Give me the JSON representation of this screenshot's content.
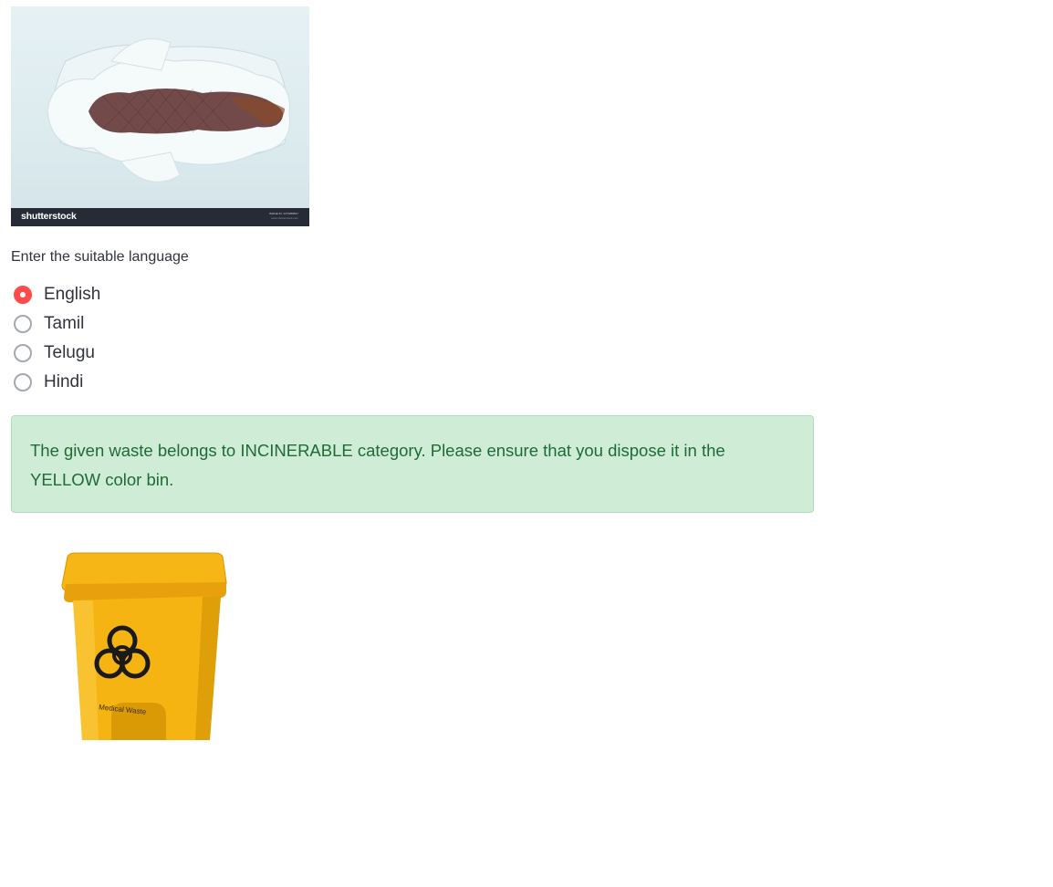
{
  "waste_image": {
    "watermark_brand": "shutterstock",
    "watermark_id_line1": "IMAGE ID: 1273068817",
    "watermark_id_line2": "www.shutterstock.com"
  },
  "language": {
    "label": "Enter the suitable language",
    "options": [
      "English",
      "Tamil",
      "Telugu",
      "Hindi"
    ],
    "selected": "English",
    "accent_color": "#ff4b4b"
  },
  "result": {
    "message": "The given waste belongs to INCINERABLE category. Please ensure that you dispose it in the YELLOW color bin.",
    "background_color": "#cfecd7",
    "text_color": "#1f6b36"
  },
  "bin_image": {
    "label": "Medical Waste",
    "bin_color": "#f5b412",
    "symbol": "biohazard-icon"
  }
}
